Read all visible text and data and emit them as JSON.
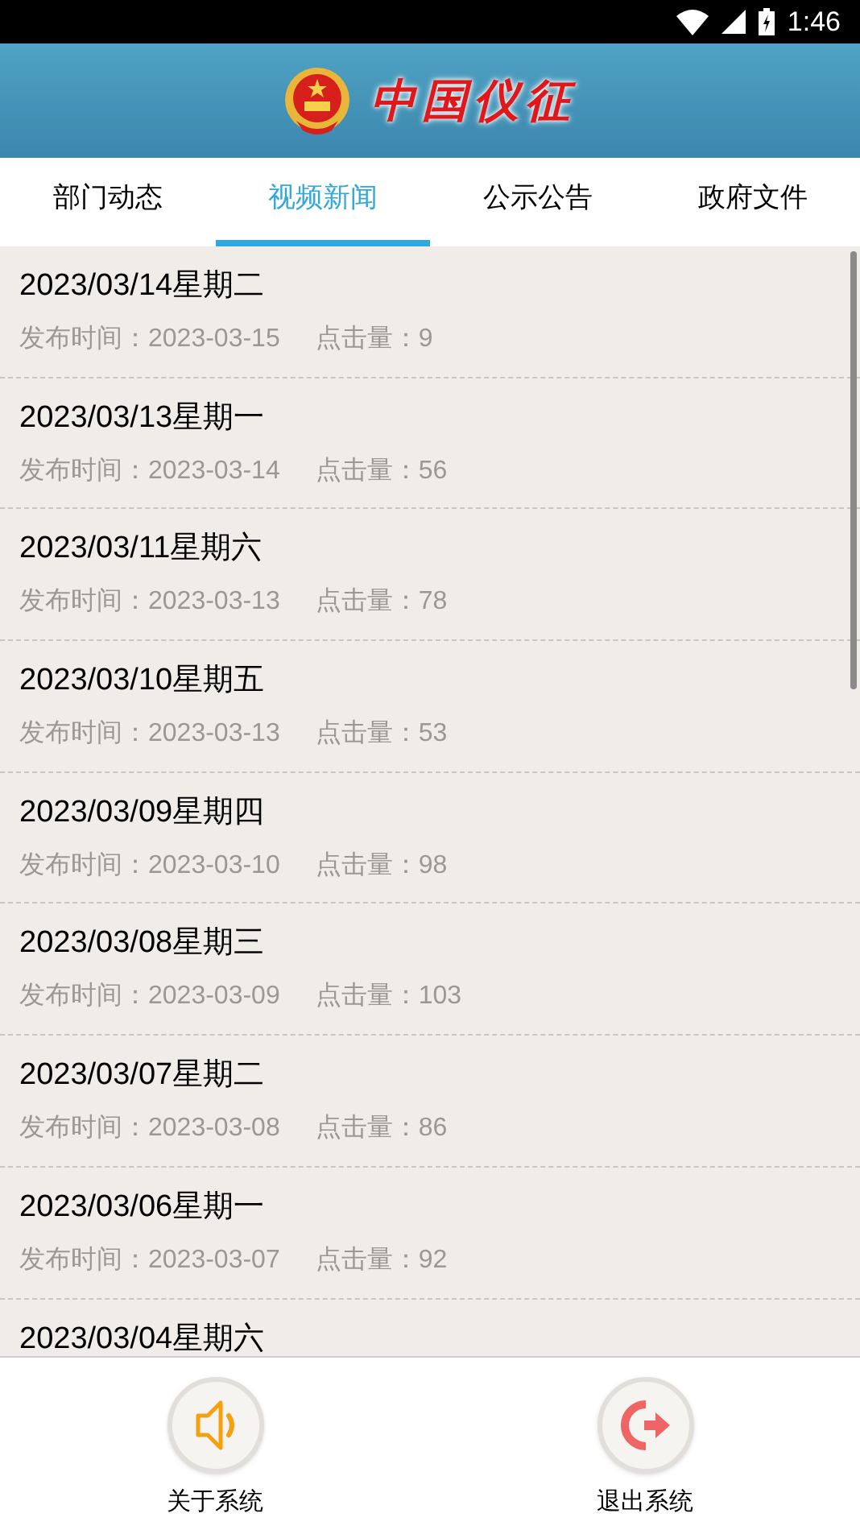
{
  "status_bar": {
    "time": "1:46"
  },
  "header": {
    "title": "中国仪征"
  },
  "tabs": [
    {
      "label": "部门动态",
      "selected": false
    },
    {
      "label": "视频新闻",
      "selected": true
    },
    {
      "label": "公示公告",
      "selected": false
    },
    {
      "label": "政府文件",
      "selected": false
    }
  ],
  "items": [
    {
      "title": "2023/03/14星期二",
      "published_label": "发布时间：",
      "published": "2023-03-15",
      "clicks_label": "点击量：",
      "clicks": "9"
    },
    {
      "title": "2023/03/13星期一",
      "published_label": "发布时间：",
      "published": "2023-03-14",
      "clicks_label": "点击量：",
      "clicks": "56"
    },
    {
      "title": "2023/03/11星期六",
      "published_label": "发布时间：",
      "published": "2023-03-13",
      "clicks_label": "点击量：",
      "clicks": "78"
    },
    {
      "title": "2023/03/10星期五",
      "published_label": "发布时间：",
      "published": "2023-03-13",
      "clicks_label": "点击量：",
      "clicks": "53"
    },
    {
      "title": "2023/03/09星期四",
      "published_label": "发布时间：",
      "published": "2023-03-10",
      "clicks_label": "点击量：",
      "clicks": "98"
    },
    {
      "title": "2023/03/08星期三",
      "published_label": "发布时间：",
      "published": "2023-03-09",
      "clicks_label": "点击量：",
      "clicks": "103"
    },
    {
      "title": "2023/03/07星期二",
      "published_label": "发布时间：",
      "published": "2023-03-08",
      "clicks_label": "点击量：",
      "clicks": "86"
    },
    {
      "title": "2023/03/06星期一",
      "published_label": "发布时间：",
      "published": "2023-03-07",
      "clicks_label": "点击量：",
      "clicks": "92"
    },
    {
      "title": "2023/03/04星期六"
    }
  ],
  "bottom_bar": [
    {
      "kind": "about",
      "label": "关于系统"
    },
    {
      "kind": "exit",
      "label": "退出系统"
    }
  ]
}
